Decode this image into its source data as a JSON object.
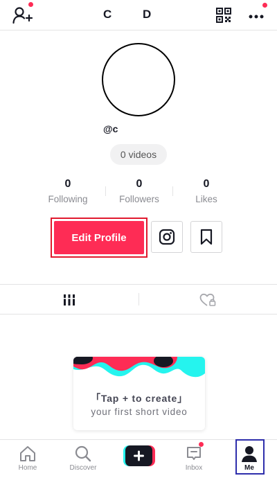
{
  "header": {
    "title_left": "C",
    "title_right": "D",
    "icons": [
      "add-user-icon",
      "qr-code-icon",
      "more-icon"
    ],
    "notification_dot_color": "#fe2c55"
  },
  "profile": {
    "username": "@c",
    "videos_label": "0 videos",
    "stats": [
      {
        "value": "0",
        "label": "Following"
      },
      {
        "value": "0",
        "label": "Followers"
      },
      {
        "value": "0",
        "label": "Likes"
      }
    ],
    "edit_button_label": "Edit Profile",
    "accent_color": "#fe2c55"
  },
  "tabs": [
    "grid-icon",
    "liked-private-icon"
  ],
  "create_card": {
    "line1": "「Tap + to create」",
    "line2": "your first short video"
  },
  "bottom_nav": {
    "items": [
      {
        "label": "Home",
        "icon": "home-icon"
      },
      {
        "label": "Discover",
        "icon": "search-icon"
      },
      {
        "label": "",
        "icon": "create-icon"
      },
      {
        "label": "Inbox",
        "icon": "inbox-icon"
      },
      {
        "label": "Me",
        "icon": "profile-icon"
      }
    ],
    "active": "Me"
  }
}
